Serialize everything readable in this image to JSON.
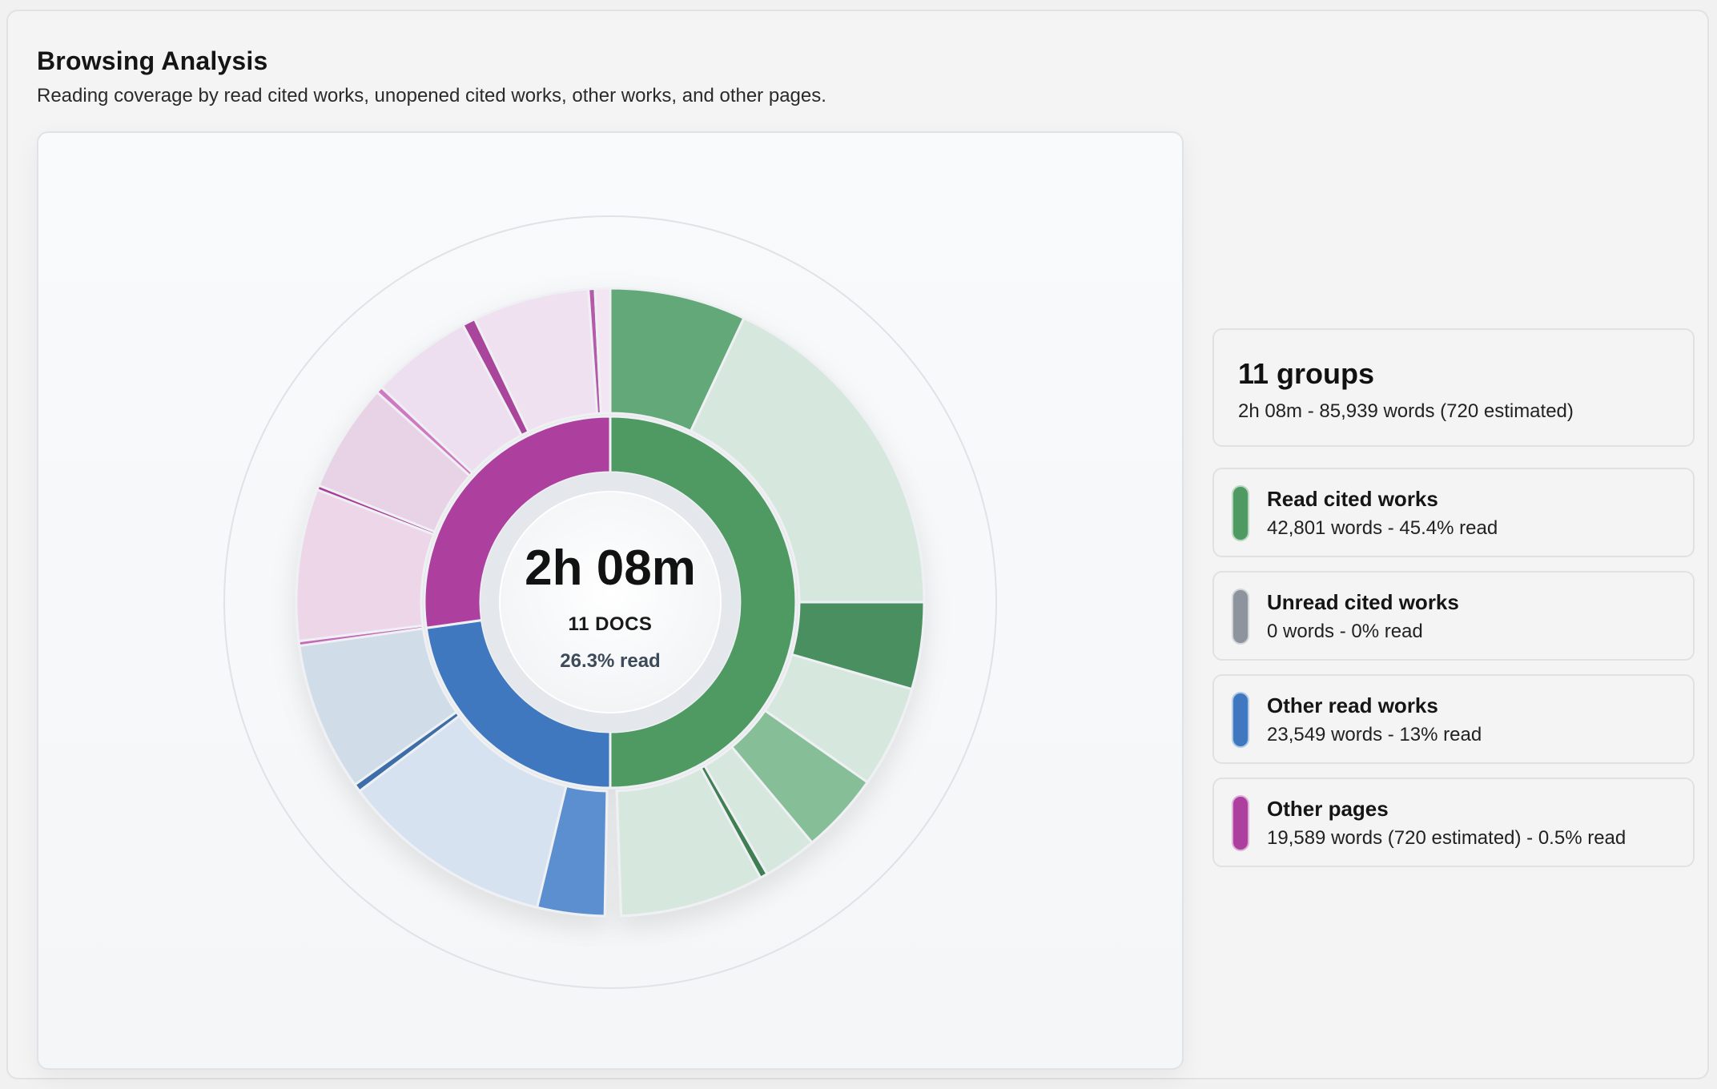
{
  "header": {
    "title": "Browsing Analysis",
    "subtitle": "Reading coverage by read cited works, unopened cited works, other works, and other pages."
  },
  "center": {
    "time": "2h 08m",
    "docs": "11 DOCS",
    "read_pct": "26.3% read"
  },
  "summary": {
    "title": "11 groups",
    "detail": "2h 08m - 85,939 words (720 estimated)"
  },
  "colors": {
    "read_cited": "#4f9a63",
    "unread_cited": "#8e949d",
    "other_read": "#3f78c0",
    "other_pages": "#ad3f9e"
  },
  "legend": [
    {
      "label": "Read cited works",
      "detail": "42,801 words - 45.4% read",
      "color": "#4f9a63"
    },
    {
      "label": "Unread cited works",
      "detail": "0 words - 0% read",
      "color": "#8e949d"
    },
    {
      "label": "Other read works",
      "detail": "23,549 words - 13% read",
      "color": "#3f78c0"
    },
    {
      "label": "Other pages",
      "detail": "19,589 words (720 estimated) - 0.5% read",
      "color": "#ad3f9e"
    }
  ],
  "chart_data": {
    "type": "sunburst",
    "inner_ring": [
      {
        "group": "Read cited works",
        "words": 42801
      },
      {
        "group": "Unread cited works",
        "words": 0
      },
      {
        "group": "Other read works",
        "words": 23549
      },
      {
        "group": "Other pages",
        "words": 19589
      }
    ],
    "outer_ring": [
      {
        "group": "Read cited works",
        "read": 0.28,
        "unread": 0.72
      },
      {
        "group": "Read cited works",
        "read": 0.46,
        "unread": 0.54
      },
      {
        "group": "Read cited works",
        "read": 0.05,
        "unread": 0.25
      },
      {
        "group": "Read cited works",
        "read": 0.6,
        "unread": 0.4
      },
      {
        "group": "Other read works",
        "read": 0.24,
        "unread": 0.76
      },
      {
        "group": "Other read works",
        "read": 0.05,
        "unread": 0.95
      },
      {
        "group": "Other pages",
        "read": 0.03,
        "unread": 0.97
      },
      {
        "group": "Other pages",
        "read": 0.04,
        "unread": 0.96
      },
      {
        "group": "Other pages",
        "read": 0.04,
        "unread": 0.96
      },
      {
        "group": "Other pages",
        "read": 0.06,
        "unread": 0.94
      },
      {
        "group": "Other pages",
        "read": 0.1,
        "unread": 0.9
      }
    ]
  }
}
